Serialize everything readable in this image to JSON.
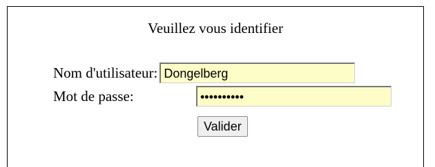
{
  "form": {
    "title": "Veuillez vous identifier",
    "username_label": "Nom d'utilisateur:",
    "username_value": "Dongelberg",
    "password_label": "Mot de passe:",
    "password_value": "••••••••••",
    "submit_label": "Valider"
  },
  "colors": {
    "field_background": "#fdfdc8",
    "button_background": "#efefef",
    "frame_border": "#000000"
  }
}
